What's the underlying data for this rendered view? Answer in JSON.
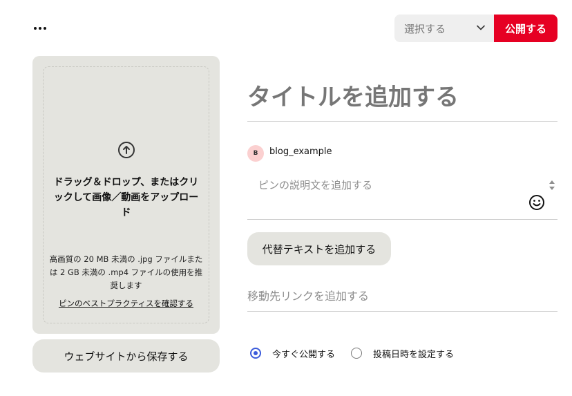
{
  "header": {
    "more_icon": "more-horizontal-icon",
    "board_select": {
      "value": "選択する",
      "icon": "chevron-down-icon"
    },
    "publish_label": "公開する",
    "publish_color": "#e60023"
  },
  "upload": {
    "icon": "arrow-up-circle-icon",
    "main_text": "ドラッグ＆ドロップ、またはクリックして画像／動画をアップロード",
    "recommendation": "高画質の 20 MB 未満の .jpg ファイルまたは 2 GB 未満の .mp4 ファイルの使用を推奨します",
    "link": "ピンのベストプラクティスを確認する"
  },
  "website_button": "ウェブサイトから保存する",
  "form": {
    "title_placeholder": "タイトルを追加する",
    "user": {
      "initial": "B",
      "name": "blog_example"
    },
    "description_placeholder": "ピンの説明文を追加する",
    "alt_text_button": "代替テキストを追加する",
    "destination_placeholder": "移動先リンクを追加する"
  },
  "publish_options": [
    {
      "label": "今すぐ公開する",
      "selected": true
    },
    {
      "label": "投稿日時を設定する",
      "selected": false
    }
  ],
  "accent_color": "#3b5bdb"
}
